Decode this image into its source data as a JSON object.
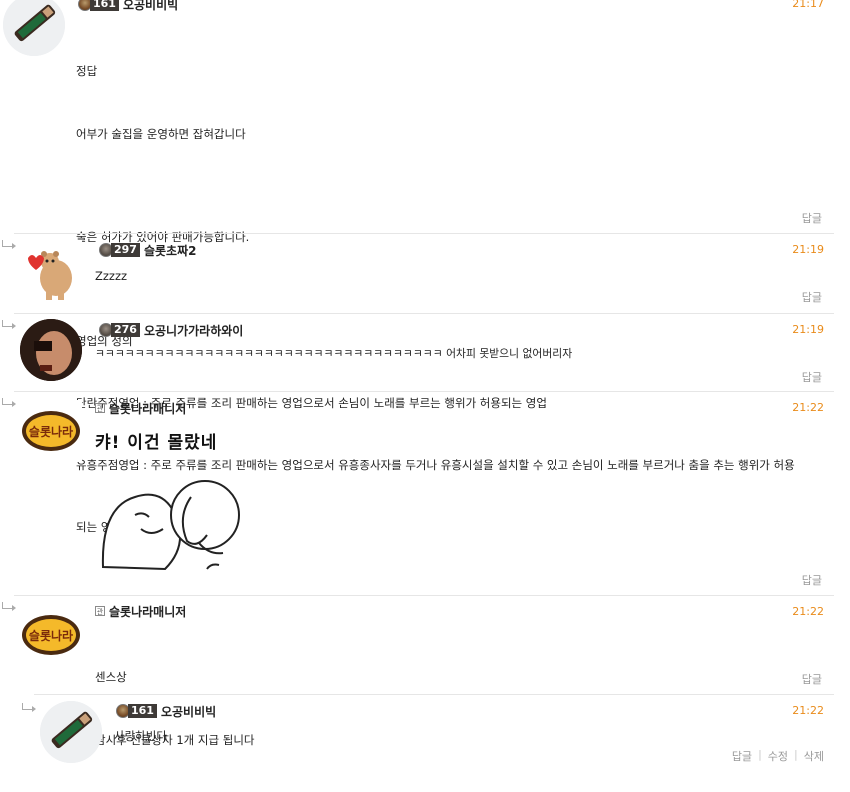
{
  "comments": [
    {
      "level": "161",
      "name": "오공비비빅",
      "time": "21:17",
      "lines": [
        "정답",
        "어부가 술집을 운영하면 잡혀갑니다",
        "",
        "술은 허가가 있어야 판매가능합니다.",
        "",
        "영업의 정의",
        "단란주점영업 : 주로 주류를 조리 판매하는 영업으로서 손님이 노래를 부르는 행위가 허용되는 영업",
        "유흥주점영업 : 주로 주류를 조리 판매하는 영업으로서 유흥종사자를 두거나 유흥시설을 설치할 수 있고 손님이 노래를 부르거나 춤을 추는 행위가 허용",
        "되는 영업"
      ],
      "reply_label": "답글"
    },
    {
      "level": "297",
      "name": "슬롯초짜2",
      "time": "21:19",
      "text": "Zzzzz",
      "reply_label": "답글"
    },
    {
      "level": "276",
      "name": "오공니가가라하와이",
      "time": "21:19",
      "text": "ㅋㅋㅋㅋㅋㅋㅋㅋㅋㅋㅋㅋㅋㅋㅋㅋㅋㅋㅋㅋㅋㅋㅋㅋㅋㅋㅋㅋㅋㅋㅋㅋㅋㅋㅋ 어차피 못받으니 없어버리자",
      "reply_label": "답글"
    },
    {
      "badge": "관",
      "name": "슬롯나라매니저",
      "time": "21:22",
      "sticker_text": "캬! 이건 몰랐네",
      "avatar_text": "슬롯나라",
      "reply_label": "답글"
    },
    {
      "badge": "관",
      "name": "슬롯나라매니저",
      "time": "21:22",
      "lines": [
        "센스상",
        "잠시후 선물상자 1개 지급 됩니다"
      ],
      "avatar_text": "슬롯나라",
      "reply_label": "답글"
    },
    {
      "level": "161",
      "name": "오공비비빅",
      "time": "21:22",
      "text": "사랑하빈다",
      "actions": [
        "답글",
        "수정",
        "삭제"
      ]
    }
  ]
}
